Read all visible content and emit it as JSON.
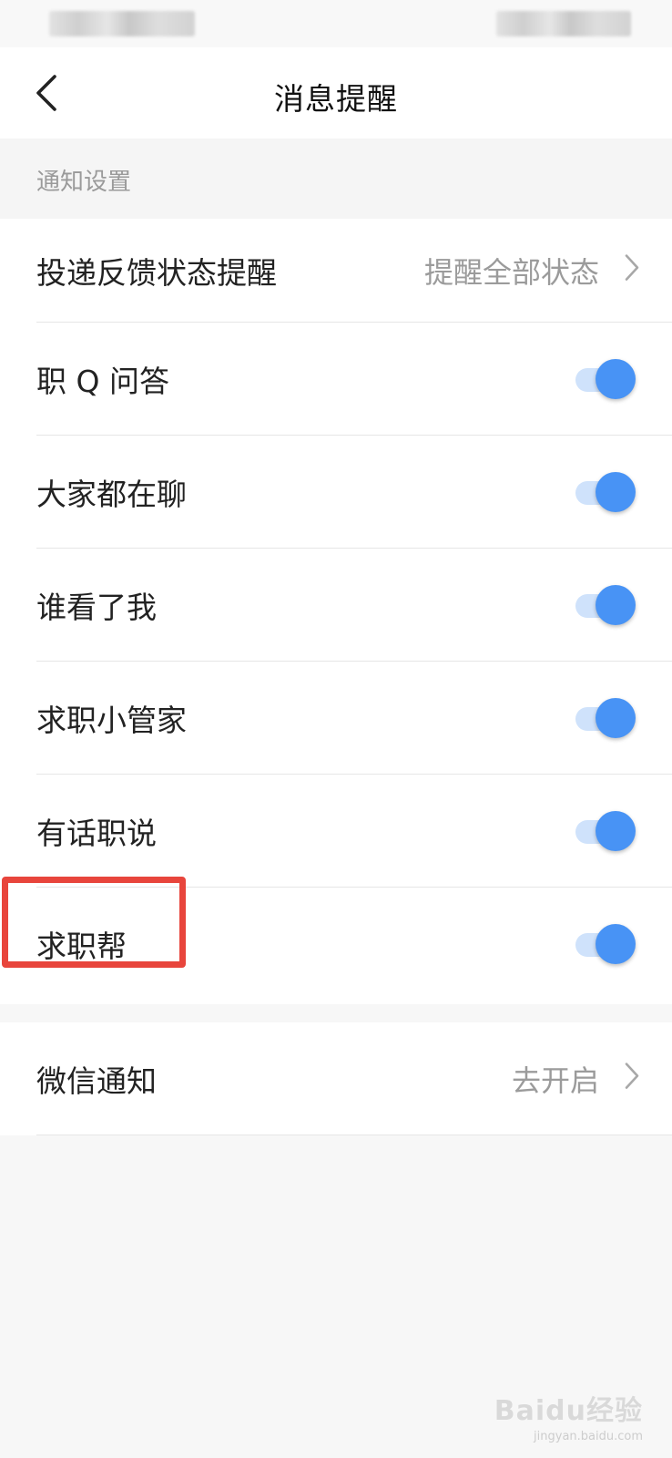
{
  "nav": {
    "title": "消息提醒",
    "back_icon": "chevron-left-icon"
  },
  "section": {
    "header": "通知设置"
  },
  "settings": {
    "items": [
      {
        "label": "投递反馈状态提醒",
        "value": "提醒全部状态",
        "control": "chevron"
      },
      {
        "label": "职 Q 问答",
        "control": "toggle",
        "on": true
      },
      {
        "label": "大家都在聊",
        "control": "toggle",
        "on": true
      },
      {
        "label": "谁看了我",
        "control": "toggle",
        "on": true
      },
      {
        "label": "求职小管家",
        "control": "toggle",
        "on": true
      },
      {
        "label": "有话职说",
        "control": "toggle",
        "on": true
      },
      {
        "label": "求职帮",
        "control": "toggle",
        "on": true,
        "highlighted": true
      }
    ]
  },
  "wechat": {
    "label": "微信通知",
    "value": "去开启",
    "control": "chevron"
  },
  "colors": {
    "toggle_on": "#4893f5",
    "toggle_track": "#cfe2fb",
    "highlight": "#e8453c",
    "secondary_text": "#9b9b9b"
  },
  "watermark": {
    "main": "Baidu经验",
    "sub": "jingyan.baidu.com"
  }
}
